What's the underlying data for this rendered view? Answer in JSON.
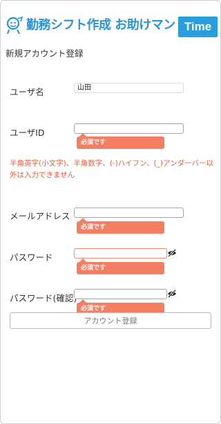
{
  "header": {
    "app_title": "勤務シフト作成 お助けマン",
    "badge": "Time"
  },
  "page_title": "新規アカウント登録",
  "form": {
    "username_label": "ユーザ名",
    "username_value": "山田",
    "userid_label": "ユーザID",
    "userid_value": "",
    "userid_required": "必須です",
    "userid_error": "半角英字(小文字)、半角数字、(-)ハイフン、(_)アンダーバー以外は入力できません",
    "email_label": "メールアドレス",
    "email_value": "",
    "email_required": "必須です",
    "password_label": "パスワード",
    "password_value": "",
    "password_required": "必須です",
    "password_confirm_label": "パスワード(確認)",
    "password_confirm_value": "",
    "password_confirm_required": "必須です",
    "submit_label": "アカウント登録"
  },
  "colors": {
    "brand": "#2a93d5",
    "error": "#f47e62",
    "error_text": "#f05a3c"
  },
  "icons": {
    "logo": "mascot-icon",
    "toggle_visibility": "eye-slash-icon"
  }
}
